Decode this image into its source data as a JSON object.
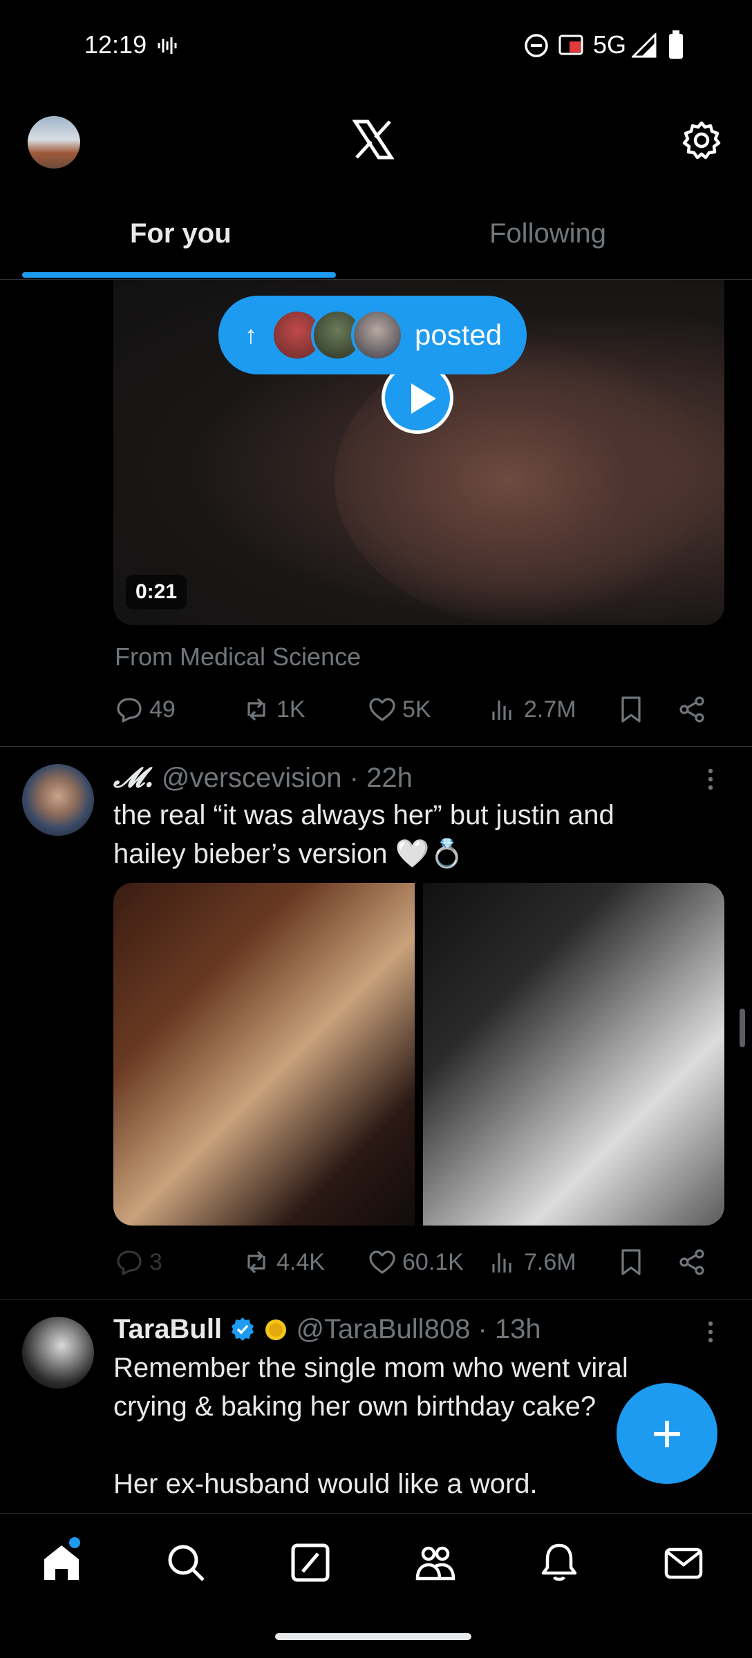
{
  "status_bar": {
    "time": "12:19",
    "network": "5G"
  },
  "tabs": [
    {
      "label": "For you",
      "active": true
    },
    {
      "label": "Following",
      "active": false
    }
  ],
  "video_post": {
    "posted_pill_label": "posted",
    "video_duration": "0:21",
    "source": "From Medical Science",
    "stats": {
      "replies": "49",
      "reposts": "1K",
      "likes": "5K",
      "views": "2.7M"
    }
  },
  "tweet2": {
    "name": "𝓜.",
    "handle": "@verscevision",
    "time": "· 22h",
    "text_line1": "the real “it was always her” but justin and",
    "text_line2": "hailey bieber’s version 🤍💍",
    "stats": {
      "replies": "3",
      "reposts": "4.4K",
      "likes": "60.1K",
      "views": "7.6M"
    }
  },
  "tweet3": {
    "name": "TaraBull",
    "handle": "@TaraBull808",
    "time": "· 13h",
    "text_line1": "Remember the single mom who went viral",
    "text_line2": "crying & baking her own birthday cake?",
    "text_line3": "Her ex-husband would like a word."
  },
  "colors": {
    "accent": "#1d9bf0",
    "muted": "#71767b",
    "text": "#e7e9ea",
    "divider": "#2f3336"
  },
  "icons": [
    "x-logo-icon",
    "settings-gear-icon",
    "reply-icon",
    "repost-icon",
    "like-icon",
    "views-icon",
    "bookmark-icon",
    "share-icon",
    "more-icon",
    "verified-badge-icon",
    "home-icon",
    "search-icon",
    "grok-icon",
    "communities-icon",
    "notifications-icon",
    "messages-icon",
    "compose-plus-icon"
  ]
}
